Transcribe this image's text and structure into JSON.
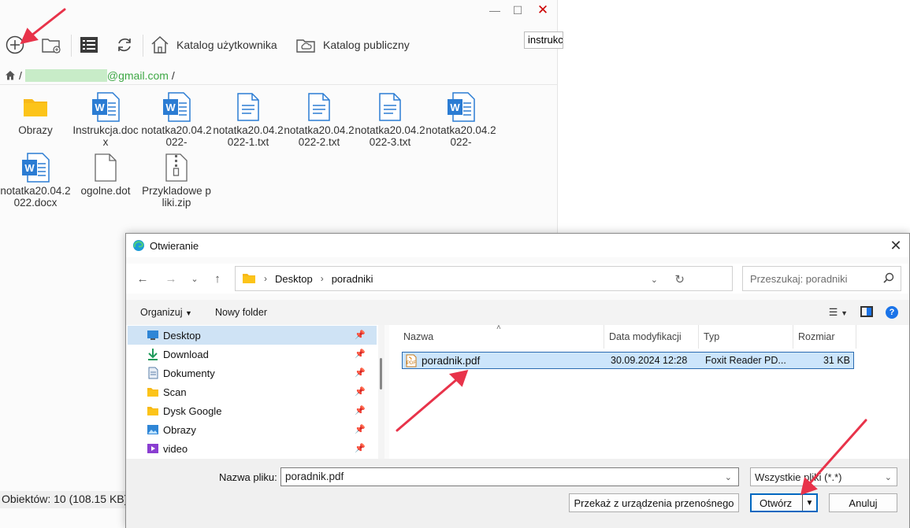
{
  "background_window": {
    "toolbar": {
      "home_label": "Katalog użytkownika",
      "public_label": "Katalog publiczny",
      "search_value": "instrukcja"
    },
    "path": {
      "separator": "/",
      "domain": "@gmail.com"
    },
    "files": [
      {
        "name": "Obrazy",
        "type": "folder"
      },
      {
        "name": "Instrukcja.docx",
        "type": "word"
      },
      {
        "name": "notatka20.04.2022-",
        "type": "word"
      },
      {
        "name": "notatka20.04.2022-1.txt",
        "type": "text"
      },
      {
        "name": "notatka20.04.2022-2.txt",
        "type": "text"
      },
      {
        "name": "notatka20.04.2022-3.txt",
        "type": "text"
      },
      {
        "name": "notatka20.04.2022-",
        "type": "word"
      },
      {
        "name": "notatka20.04.2022.docx",
        "type": "word"
      },
      {
        "name": "ogolne.dot",
        "type": "blank"
      },
      {
        "name": "Przykladowe pliki.zip",
        "type": "zip"
      }
    ],
    "status": "Obiektów: 10 (108.15 KB)"
  },
  "dialog": {
    "title": "Otwieranie",
    "address": {
      "crumbs": [
        "Desktop",
        "poradniki"
      ]
    },
    "search_placeholder": "Przeszukaj: poradniki",
    "commands": {
      "organize": "Organizuj",
      "new_folder": "Nowy folder"
    },
    "nav_items": [
      {
        "label": "Desktop",
        "icon": "desktop-icon",
        "selected": true
      },
      {
        "label": "Download",
        "icon": "download-icon",
        "selected": false
      },
      {
        "label": "Dokumenty",
        "icon": "documents-icon",
        "selected": false
      },
      {
        "label": "Scan",
        "icon": "folder-icon",
        "selected": false
      },
      {
        "label": "Dysk Google",
        "icon": "folder-icon",
        "selected": false
      },
      {
        "label": "Obrazy",
        "icon": "pictures-icon",
        "selected": false
      },
      {
        "label": "video",
        "icon": "video-icon",
        "selected": false
      }
    ],
    "columns": {
      "name": "Nazwa",
      "date": "Data modyfikacji",
      "type": "Typ",
      "size": "Rozmiar"
    },
    "file_row": {
      "name": "poradnik.pdf",
      "date": "30.09.2024 12:28",
      "type": "Foxit Reader PD...",
      "size": "31 KB"
    },
    "filename_label": "Nazwa pliku:",
    "filename_value": "poradnik.pdf",
    "filetype_value": "Wszystkie pliki (*.*)",
    "buttons": {
      "device": "Przekaż z urządzenia przenośnego",
      "open": "Otwórz",
      "cancel": "Anuluj"
    }
  },
  "colors": {
    "accent": "#0067c0",
    "arrow": "#e8334a",
    "selection": "#cce5fb"
  }
}
